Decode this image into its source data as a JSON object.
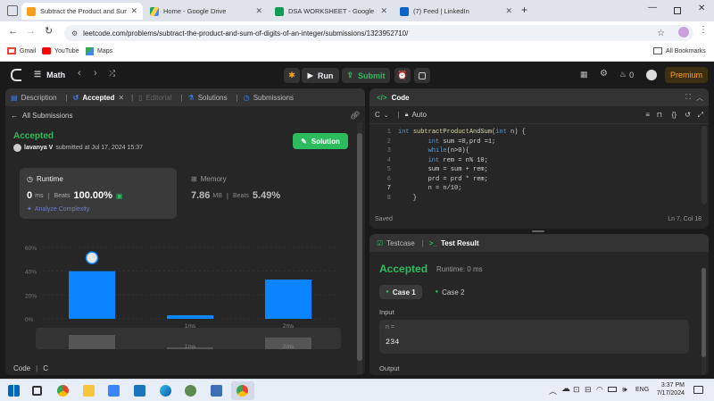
{
  "browser": {
    "tabs": [
      {
        "title": "Subtract the Product and Sum",
        "active": true,
        "icon_color": "#f89f1b"
      },
      {
        "title": "Home - Google Drive",
        "active": false,
        "icon_color": "#1fa463"
      },
      {
        "title": "DSA WORKSHEET - Google She",
        "active": false,
        "icon_color": "#0f9d58"
      },
      {
        "title": "(7) Feed | LinkedIn",
        "active": false,
        "icon_color": "#0a66c2"
      }
    ],
    "url": "leetcode.com/problems/subtract-the-product-and-sum-of-digits-of-an-integer/submissions/1323952710/",
    "bookmarks": [
      "Gmail",
      "YouTube",
      "Maps"
    ],
    "all_bookmarks": "All Bookmarks"
  },
  "nav": {
    "problem_list": "Math",
    "run": "Run",
    "submit": "Submit",
    "fire_count": "0",
    "premium": "Premium"
  },
  "left": {
    "tabs": {
      "description": "Description",
      "accepted": "Accepted",
      "editorial": "Editorial",
      "solutions": "Solutions",
      "submissions": "Submissions"
    },
    "all_submissions": "All Submissions",
    "status": "Accepted",
    "user": "lavanya V",
    "submitted_at": "submitted at Jul 17, 2024 15:37",
    "solution_btn": "Solution",
    "runtime": {
      "label": "Runtime",
      "value": "0",
      "unit": "ms",
      "beats_label": "Beats",
      "beats": "100.00%",
      "analyze": "Analyze Complexity"
    },
    "memory": {
      "label": "Memory",
      "value": "7.86",
      "unit": "MB",
      "beats_label": "Beats",
      "beats": "5.49%"
    },
    "footer_code": "Code",
    "footer_lang": "C"
  },
  "chart_data": {
    "type": "bar",
    "categories": [
      "",
      "1ms",
      "2ms"
    ],
    "values": [
      40,
      3,
      33
    ],
    "yticks": [
      "60%",
      "40%",
      "20%",
      "0%"
    ],
    "ylim": [
      0,
      60
    ],
    "highlight_index": 0,
    "bar_color": "#0a84ff"
  },
  "editor": {
    "title": "Code",
    "lang": "C",
    "mode": "Auto",
    "lines": [
      {
        "n": "1",
        "text": "int subtractProductAndSum(int n) {"
      },
      {
        "n": "2",
        "text": "        int sum =0,prd =1;"
      },
      {
        "n": "3",
        "text": "        while(n>0){"
      },
      {
        "n": "4",
        "text": "        int rem = n% 10;"
      },
      {
        "n": "5",
        "text": "        sum = sum + rem;"
      },
      {
        "n": "6",
        "text": "        prd = prd * rem;"
      },
      {
        "n": "7",
        "text": "        n = n/10;"
      },
      {
        "n": "8",
        "text": "    }"
      }
    ],
    "saved": "Saved",
    "cursor": "Ln 7, Col 18"
  },
  "result": {
    "tab_testcase": "Testcase",
    "tab_result": "Test Result",
    "status": "Accepted",
    "runtime": "Runtime: 0 ms",
    "case1": "Case 1",
    "case2": "Case 2",
    "input_label": "Input",
    "var_name": "n =",
    "var_value": "234",
    "output_label": "Output"
  },
  "taskbar": {
    "lang": "ENG",
    "time": "3:37 PM",
    "date": "7/17/2024"
  }
}
